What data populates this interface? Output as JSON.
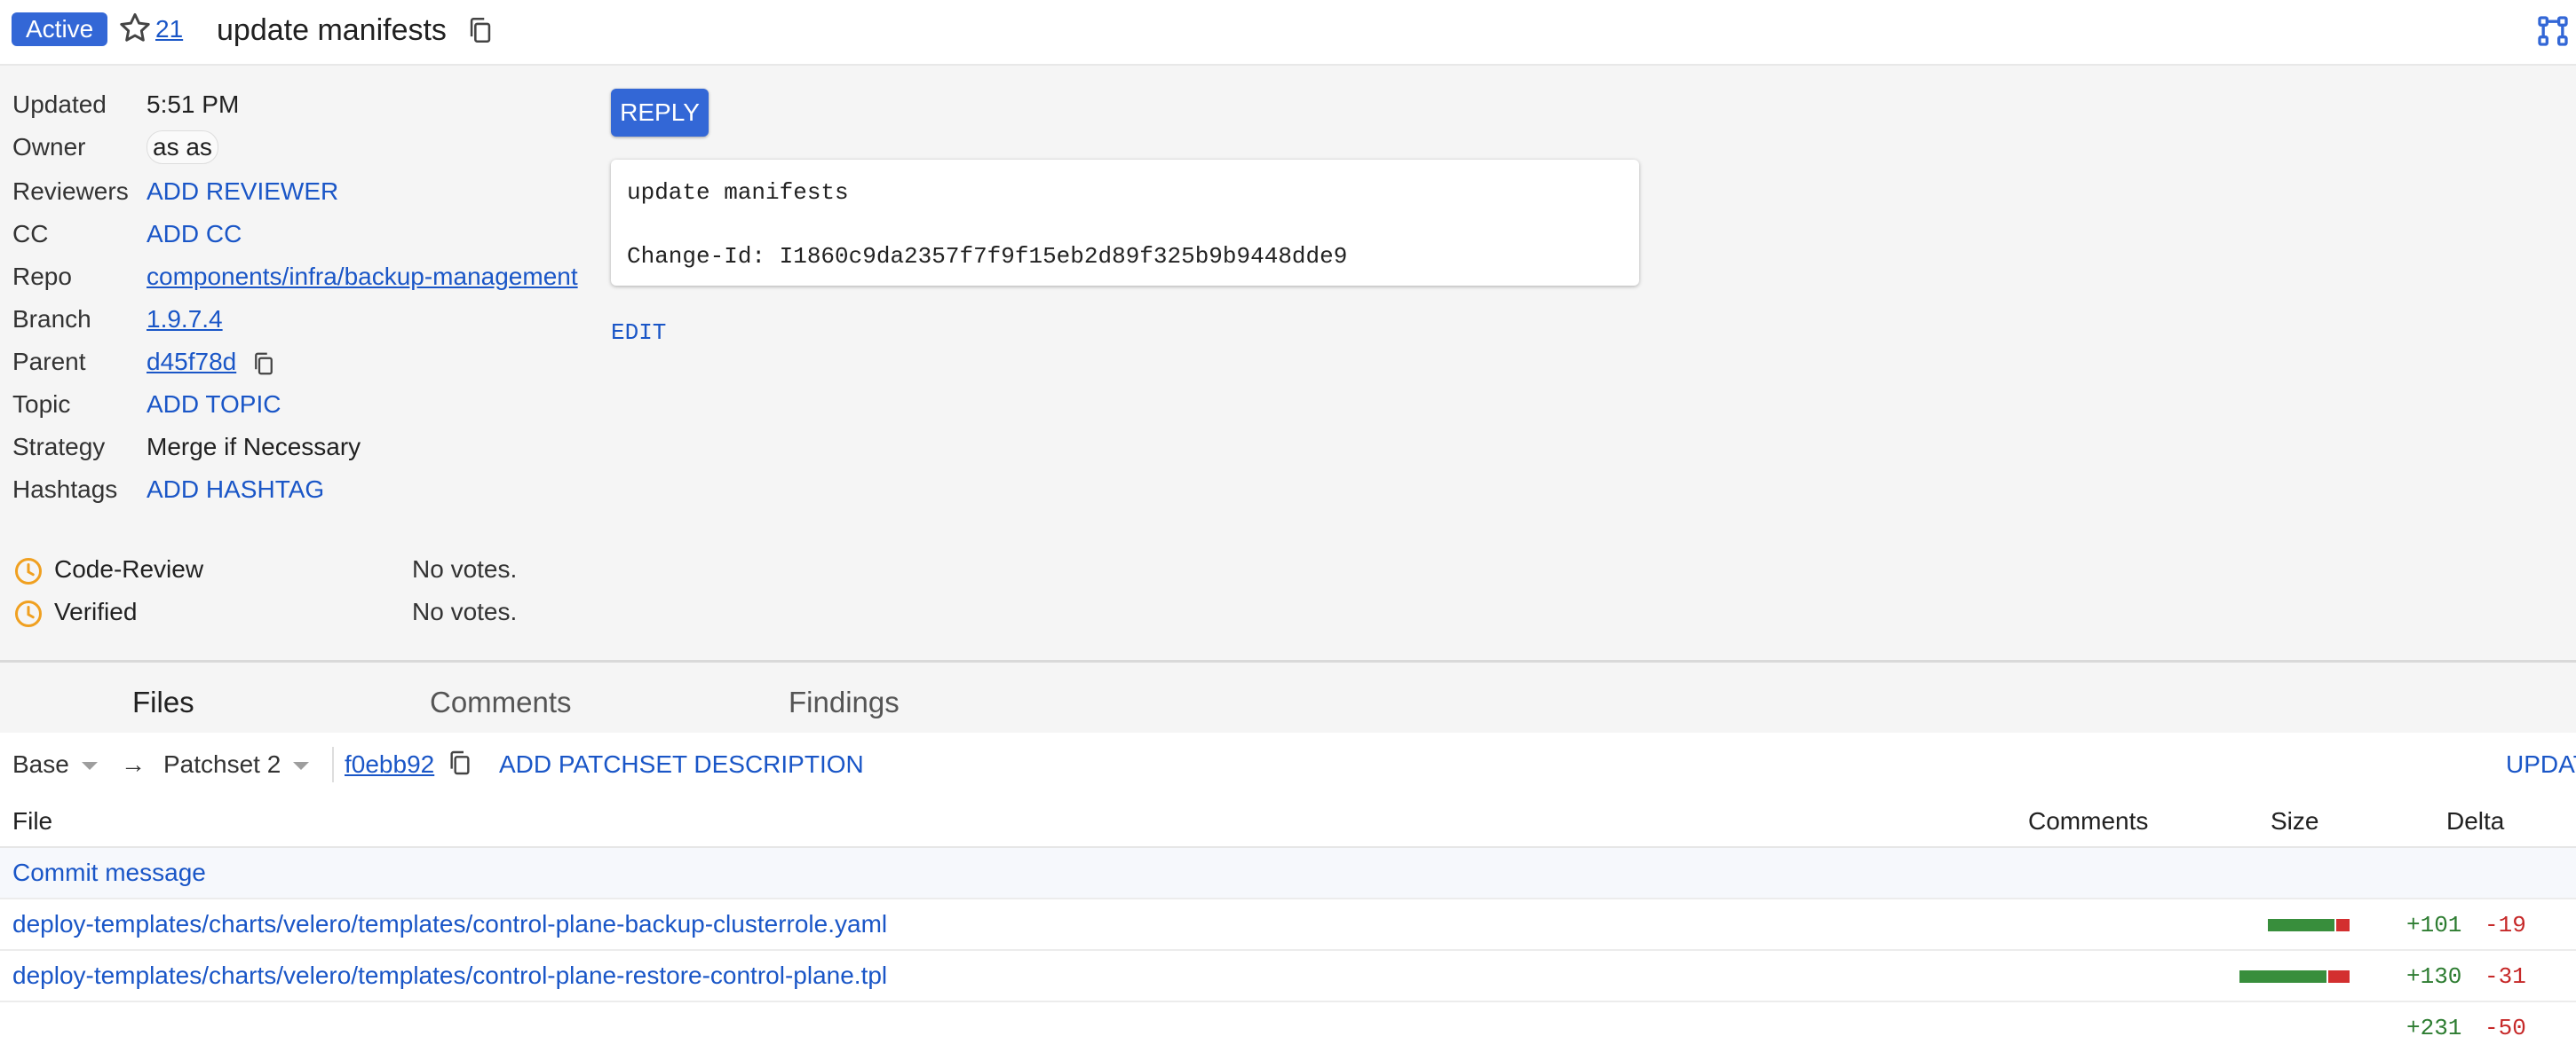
{
  "header": {
    "status": "Active",
    "star_count": "21",
    "subject": "update manifests"
  },
  "info": {
    "updated_label": "Updated",
    "updated_value": "5:51 PM",
    "owner_label": "Owner",
    "owner_value": "as as",
    "reviewers_label": "Reviewers",
    "reviewers_action": "ADD REVIEWER",
    "cc_label": "CC",
    "cc_action": "ADD CC",
    "repo_label": "Repo",
    "repo_value": "components/infra/backup-management",
    "branch_label": "Branch",
    "branch_value": "1.9.7.4",
    "parent_label": "Parent",
    "parent_value": "d45f78d",
    "topic_label": "Topic",
    "topic_action": "ADD TOPIC",
    "strategy_label": "Strategy",
    "strategy_value": "Merge if Necessary",
    "hashtags_label": "Hashtags",
    "hashtags_action": "ADD HASHTAG"
  },
  "labels": [
    {
      "name": "Code-Review",
      "votes": "No votes."
    },
    {
      "name": "Verified",
      "votes": "No votes."
    }
  ],
  "commit": {
    "reply_label": "REPLY",
    "message_subject": "update manifests",
    "change_id": "Change-Id: I1860c9da2357f7f9f15eb2d89f325b9b9448dde9",
    "edit_label": "EDIT"
  },
  "tabs": [
    "Files",
    "Comments",
    "Findings"
  ],
  "patchset_bar": {
    "base": "Base",
    "arrow": "→",
    "patchset": "Patchset 2",
    "commit_sha": "f0ebb92",
    "add_description": "ADD PATCHSET DESCRIPTION",
    "update": "UPDAT"
  },
  "file_table": {
    "headers": {
      "file": "File",
      "comments": "Comments",
      "size": "Size",
      "delta": "Delta"
    },
    "commit_message": "Commit message",
    "rows": [
      {
        "path": "deploy-templates/charts/velero/templates/control-plane-backup-clusterrole.yaml",
        "added": "+101",
        "removed": "-19",
        "added_n": 101,
        "removed_n": 19
      },
      {
        "path": "deploy-templates/charts/velero/templates/control-plane-restore-control-plane.tpl",
        "added": "+130",
        "removed": "-31",
        "added_n": 130,
        "removed_n": 31
      }
    ],
    "total_added": "+231",
    "total_removed": "-50"
  },
  "colors": {
    "accent": "#3367d6",
    "link": "#1a56c7",
    "added": "#388e3c",
    "removed": "#d32f2f",
    "clock": "#f0a020"
  }
}
